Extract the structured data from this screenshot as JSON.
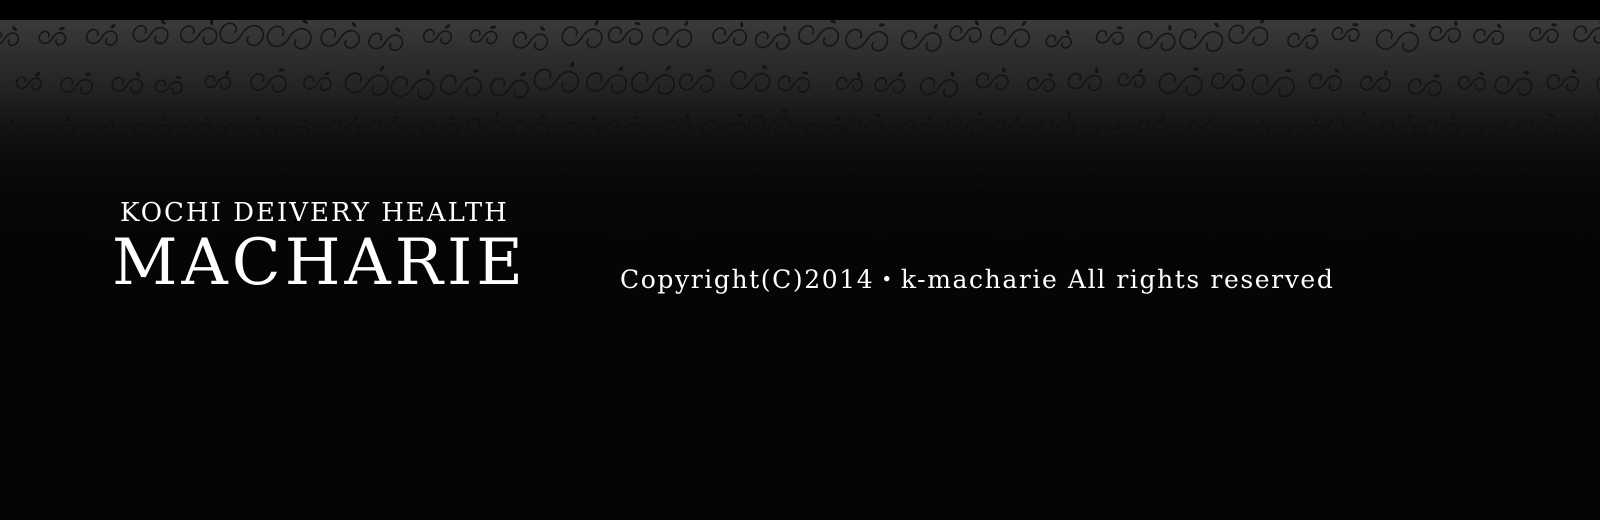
{
  "header": {
    "brand_subtitle": "KOCHI DEIVERY HEALTH",
    "brand_title": "MACHARIE"
  },
  "footer": {
    "copyright": "Copyright(C)2014・k-macharie All rights reserved"
  },
  "colors": {
    "background": "#050505",
    "text": "#ffffff",
    "ornament": "#1a1414"
  }
}
